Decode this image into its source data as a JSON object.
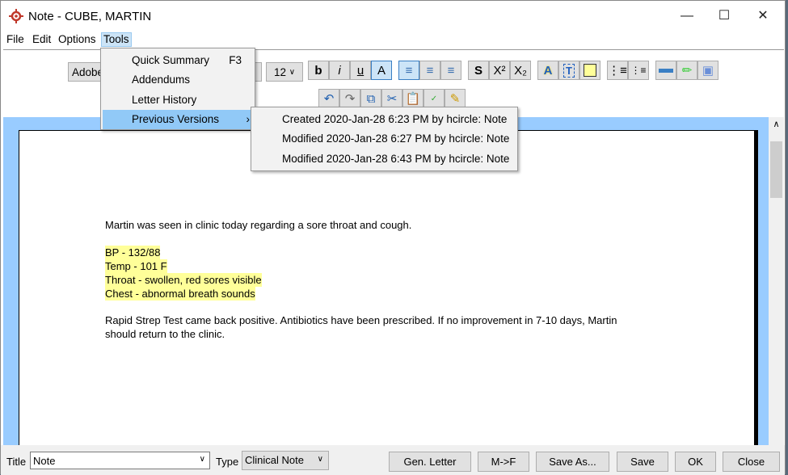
{
  "window": {
    "title": "Note - CUBE, MARTIN"
  },
  "menubar": [
    "File",
    "Edit",
    "Options",
    "Tools"
  ],
  "toolbar": {
    "font": "Adobe",
    "size": "12",
    "format_buttons": [
      "b",
      "i",
      "u",
      "A"
    ],
    "script_buttons": [
      "S",
      "X²",
      "X₂"
    ]
  },
  "tools_menu": {
    "items": [
      {
        "label": "Quick Summary",
        "shortcut": "F3"
      },
      {
        "label": "Addendums"
      },
      {
        "label": "Letter History"
      },
      {
        "label": "Previous Versions",
        "submenu": true
      }
    ]
  },
  "versions_menu": [
    "Created 2020-Jan-28 6:23 PM by hcircle: Note",
    "Modified 2020-Jan-28 6:27 PM by hcircle: Note",
    "Modified 2020-Jan-28 6:43 PM by hcircle: Note"
  ],
  "document": {
    "intro": "Martin was seen in clinic today regarding a sore throat and cough.",
    "vitals": [
      "BP - 132/88",
      "Temp - 101 F",
      "Throat - swollen, red sores visible",
      "Chest - abnormal breath sounds"
    ],
    "line1": "Rapid Strep Test came back positive.  Antibiotics have been prescribed.  If no improvement in 7-10 days, Martin",
    "line2": "should return to the clinic.",
    "highlight_color": "#ffff99"
  },
  "bottom": {
    "title_label": "Title",
    "title_value": "Note",
    "type_label": "Type",
    "type_value": "Clinical Note",
    "buttons": [
      "Gen. Letter",
      "M->F",
      "Save As...",
      "Save",
      "OK",
      "Close"
    ]
  }
}
